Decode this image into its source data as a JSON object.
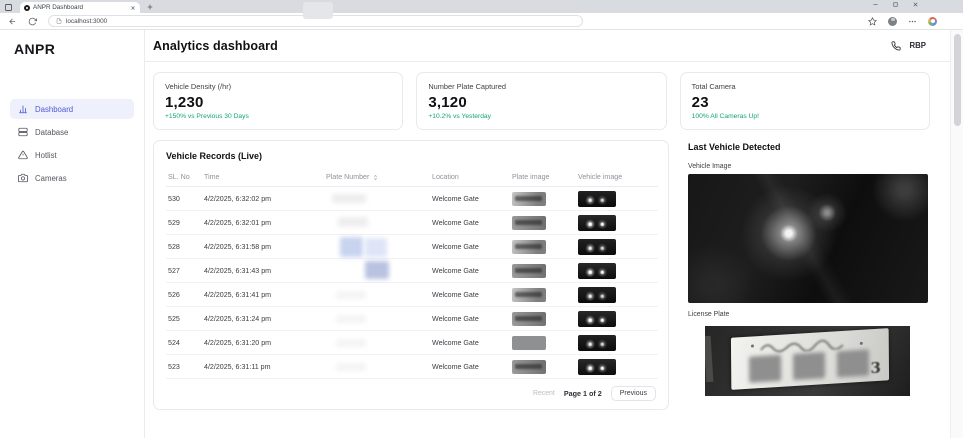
{
  "browser": {
    "tab_title": "ANPR Dashboard",
    "url": "localhost:3000"
  },
  "sidebar": {
    "logo": "ANPR",
    "items": [
      {
        "label": "Dashboard",
        "icon": "bar-chart-icon",
        "active": true
      },
      {
        "label": "Database",
        "icon": "database-icon",
        "active": false
      },
      {
        "label": "Hotlist",
        "icon": "warning-triangle-icon",
        "active": false
      },
      {
        "label": "Cameras",
        "icon": "camera-icon",
        "active": false
      }
    ]
  },
  "header": {
    "title": "Analytics dashboard",
    "user_label": "RBP"
  },
  "stats": [
    {
      "label": "Vehicle Density (/hr)",
      "value": "1,230",
      "delta": "+150% vs Previous 30 Days"
    },
    {
      "label": "Number Plate Captured",
      "value": "3,120",
      "delta": "+10.2% vs Yesterday"
    },
    {
      "label": "Total Camera",
      "value": "23",
      "delta": "100% All Cameras Up!"
    }
  ],
  "records": {
    "title": "Vehicle Records (Live)",
    "columns": [
      "SL. No",
      "Time",
      "Plate Number",
      "Location",
      "Plate image",
      "Vehicle image"
    ],
    "rows": [
      {
        "sl": "530",
        "time": "4/2/2025, 6:32:02 pm",
        "plate": "",
        "location": "Welcome Gate"
      },
      {
        "sl": "529",
        "time": "4/2/2025, 6:32:01 pm",
        "plate": "",
        "location": "Welcome Gate"
      },
      {
        "sl": "528",
        "time": "4/2/2025, 6:31:58 pm",
        "plate": "",
        "location": "Welcome Gate"
      },
      {
        "sl": "527",
        "time": "4/2/2025, 6:31:43 pm",
        "plate": "",
        "location": "Welcome Gate"
      },
      {
        "sl": "526",
        "time": "4/2/2025, 6:31:41 pm",
        "plate": "",
        "location": "Welcome Gate"
      },
      {
        "sl": "525",
        "time": "4/2/2025, 6:31:24 pm",
        "plate": "",
        "location": "Welcome Gate"
      },
      {
        "sl": "524",
        "time": "4/2/2025, 6:31:20 pm",
        "plate": "",
        "location": "Welcome Gate"
      },
      {
        "sl": "523",
        "time": "4/2/2025, 6:31:11 pm",
        "plate": "",
        "location": "Welcome Gate"
      }
    ],
    "pagination": {
      "recent": "Recent",
      "page_info": "Page 1 of 2",
      "previous": "Previous"
    }
  },
  "detected": {
    "title": "Last Vehicle Detected",
    "vehicle_image_label": "Vehicle Image",
    "license_plate_label": "License Plate",
    "plate_visible_text": "3"
  },
  "colors": {
    "accent": "#4F5BD5",
    "positive": "#12A37A"
  }
}
